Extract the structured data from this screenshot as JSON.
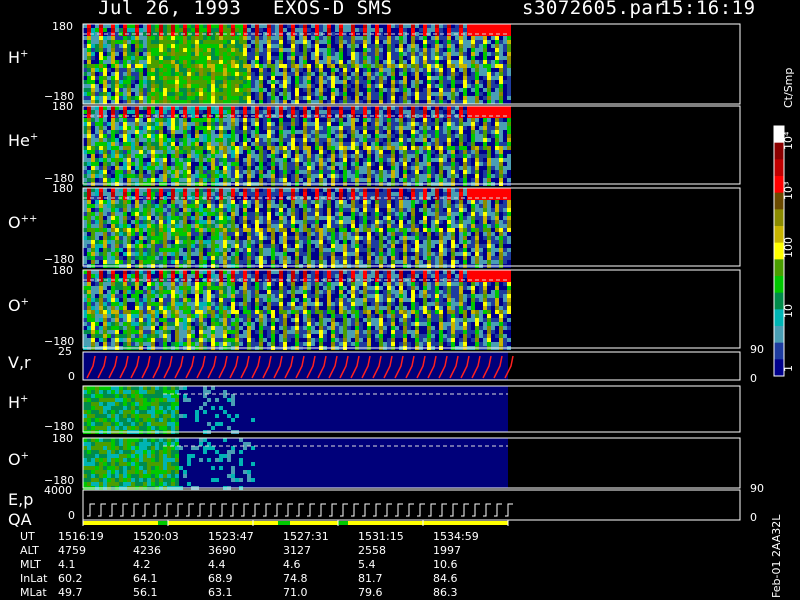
{
  "header": {
    "date": "Jul 26, 1993",
    "mission": "EXOS-D SMS",
    "file": "s3072605.par",
    "time": "15:16:19"
  },
  "panels": {
    "h_plus": {
      "label": "H",
      "sup": "+",
      "ymax": "180",
      "ymin": "−180"
    },
    "he_plus": {
      "label": "He",
      "sup": "+",
      "ymax": "180",
      "ymin": "−180"
    },
    "o_pp": {
      "label": "O",
      "sup": "++",
      "ymax": "180",
      "ymin": "−180"
    },
    "o_plus": {
      "label": "O",
      "sup": "+",
      "ymax": "180",
      "ymin": "−180"
    },
    "vr": {
      "label": "V,r",
      "ymax": "25",
      "ymin": "0",
      "rmax": "90",
      "rmin": "0"
    },
    "h_plus2": {
      "label": "H",
      "sup": "+",
      "ymax": "180",
      "ymin": "−180"
    },
    "o_plus2": {
      "label": "O",
      "sup": "+",
      "ymax": "180",
      "ymin": "−180"
    },
    "ep": {
      "label": "E,p",
      "ymax": "4000",
      "rmax": "90",
      "qa": "QA",
      "qmin": "0",
      "rmin": "0"
    }
  },
  "colorbar": {
    "unit": "Ct/Smp",
    "ticks": [
      "10⁴",
      "10³",
      "100",
      "10",
      "1"
    ],
    "colors": [
      "#ffffff",
      "#8b0000",
      "#c00000",
      "#ff0000",
      "#6b4a00",
      "#8b8b00",
      "#c8b400",
      "#ffff00",
      "#4a9e00",
      "#00c800",
      "#008b4a",
      "#00b4b4",
      "#4a9eb4",
      "#1e3ca0",
      "#00008b"
    ]
  },
  "side_label": "Feb-01 2AA32L",
  "ephemeris": {
    "labels": [
      "UT",
      "ALT",
      "MLT",
      "InLat",
      "MLat"
    ],
    "columns": [
      [
        "1516:19",
        "4759",
        "4.1",
        "60.2",
        "49.7"
      ],
      [
        "1520:03",
        "4236",
        "4.2",
        "64.1",
        "56.1"
      ],
      [
        "1523:47",
        "3690",
        "4.4",
        "68.9",
        "63.1"
      ],
      [
        "1527:31",
        "3127",
        "4.6",
        "74.8",
        "71.0"
      ],
      [
        "1531:15",
        "2558",
        "5.4",
        "81.7",
        "79.6"
      ],
      [
        "1534:59",
        "1997",
        "10.6",
        "84.6",
        "86.3"
      ]
    ]
  },
  "chart_data": {
    "type": "heatmap",
    "title": "Jul 26, 1993   EXOS-D SMS",
    "x_ticks": [
      "1516:19",
      "1520:03",
      "1523:47",
      "1527:31",
      "1531:15",
      "1534:59"
    ],
    "series": [
      {
        "name": "H+",
        "ylim": [
          -180,
          180
        ]
      },
      {
        "name": "He+",
        "ylim": [
          -180,
          180
        ]
      },
      {
        "name": "O++",
        "ylim": [
          -180,
          180
        ]
      },
      {
        "name": "O+",
        "ylim": [
          -180,
          180
        ]
      },
      {
        "name": "V,r",
        "ylim": [
          0,
          25
        ],
        "right_ylim": [
          0,
          90
        ]
      },
      {
        "name": "H+",
        "ylim": [
          -180,
          180
        ]
      },
      {
        "name": "O+",
        "ylim": [
          -180,
          180
        ]
      },
      {
        "name": "E,p",
        "ylim": [
          0,
          4000
        ],
        "right_ylim": [
          0,
          90
        ]
      }
    ],
    "colorbar_unit": "Ct/Smp",
    "colorbar_range": [
      1,
      10000
    ],
    "colorbar_scale": "log"
  }
}
